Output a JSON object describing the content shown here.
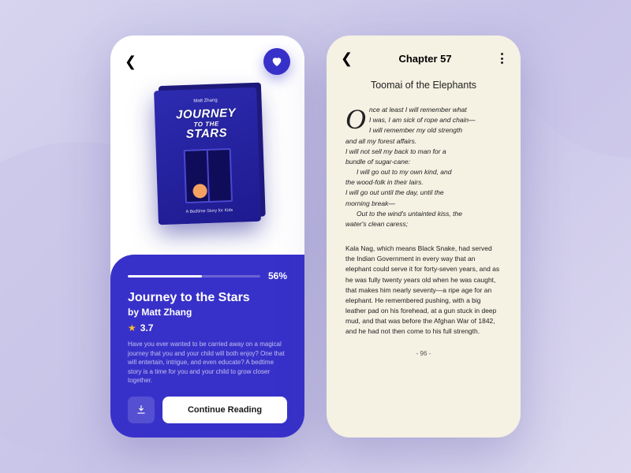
{
  "colors": {
    "primary": "#3831c9",
    "accent_star": "#fbbf24",
    "paper": "#f5f1e3"
  },
  "detail_screen": {
    "cover": {
      "author_label": "Matt Zhang",
      "title_line1": "JOURNEY",
      "title_connector": "TO THE",
      "title_line2": "STARS",
      "subtitle": "A Bedtime Story for Kids"
    },
    "progress": {
      "percent": 56,
      "label": "56%"
    },
    "title": "Journey to the Stars",
    "author": "by Matt Zhang",
    "rating": "3.7",
    "description": "Have you ever wanted to be carried away on a magical journey that you and your child will both enjoy? One that will entertain, intrigue, and even educate? A bedtime story is a time for you and your child to grow closer together.",
    "download_icon": "download-icon",
    "continue_label": "Continue Reading",
    "favorite_icon": "heart-icon"
  },
  "reader_screen": {
    "chapter": "Chapter 57",
    "story_title": "Toomai of the Elephants",
    "poem_lines": [
      {
        "text": "nce at least I will remember what",
        "indent": false,
        "dropcap": "O"
      },
      {
        "text": "I was, I am sick of rope and chain—",
        "indent": false
      },
      {
        "text": "I will remember my old strength",
        "indent": true
      },
      {
        "text": "and all my forest affairs.",
        "indent": false
      },
      {
        "text": "I will not sell my back to man for a",
        "indent": false
      },
      {
        "text": "bundle of sugar-cane:",
        "indent": false
      },
      {
        "text": "I will go out to my own kind, and",
        "indent": true
      },
      {
        "text": "the wood-folk in their lairs.",
        "indent": false
      },
      {
        "text": "I will go out until the day, until the",
        "indent": false
      },
      {
        "text": "morning break—",
        "indent": false
      },
      {
        "text": "Out to the wind's untainted kiss, the",
        "indent": true
      },
      {
        "text": "water's clean caress;",
        "indent": false
      }
    ],
    "prose": "Kala Nag, which means Black Snake, had served the Indian Government in every way that an elephant could serve it for forty-seven years, and as he was fully twenty years old when he was caught, that makes him nearly seventy—a ripe age for an elephant. He remembered pushing, with a big leather pad on his forehead, at a gun stuck in deep mud, and that was before the Afghan War of 1842, and he had not then come to his full strength.",
    "page": "- 96 -"
  }
}
